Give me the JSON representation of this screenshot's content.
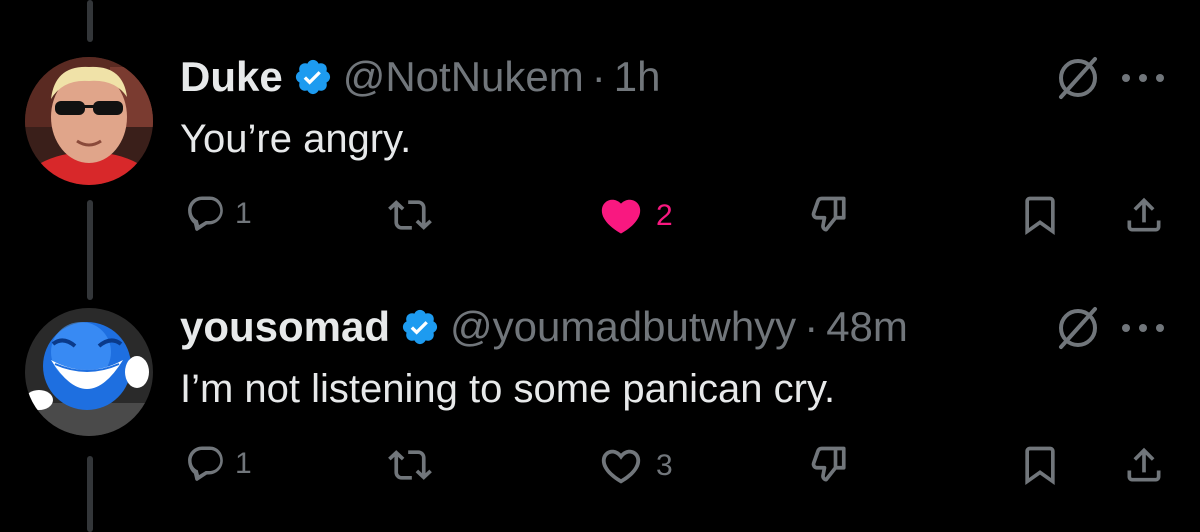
{
  "colors": {
    "background": "#000000",
    "text": "#e7e9ea",
    "secondary": "#71767b",
    "like": "#f91880",
    "verified": "#1d9bf0"
  },
  "tweets": [
    {
      "name": "Duke",
      "handle": "@NotNukem",
      "separator": "·",
      "time": "1h",
      "text": "You’re angry.",
      "verified": true,
      "avatar": "man-with-sunglasses-avatar",
      "reply_count": "1",
      "like_count": "2",
      "liked": true
    },
    {
      "name": "yousomad",
      "handle": "@youmadbutwhyy",
      "separator": "·",
      "time": "48m",
      "text": "I’m not listening to some panican cry.",
      "verified": true,
      "avatar": "laughing-blue-emoji-avatar",
      "reply_count": "1",
      "like_count": "3",
      "liked": false
    }
  ],
  "icons": [
    "reply-icon",
    "retweet-icon",
    "like-icon",
    "dislike-icon",
    "bookmark-icon",
    "share-icon",
    "grok-icon",
    "more-icon",
    "verified-badge-icon"
  ]
}
